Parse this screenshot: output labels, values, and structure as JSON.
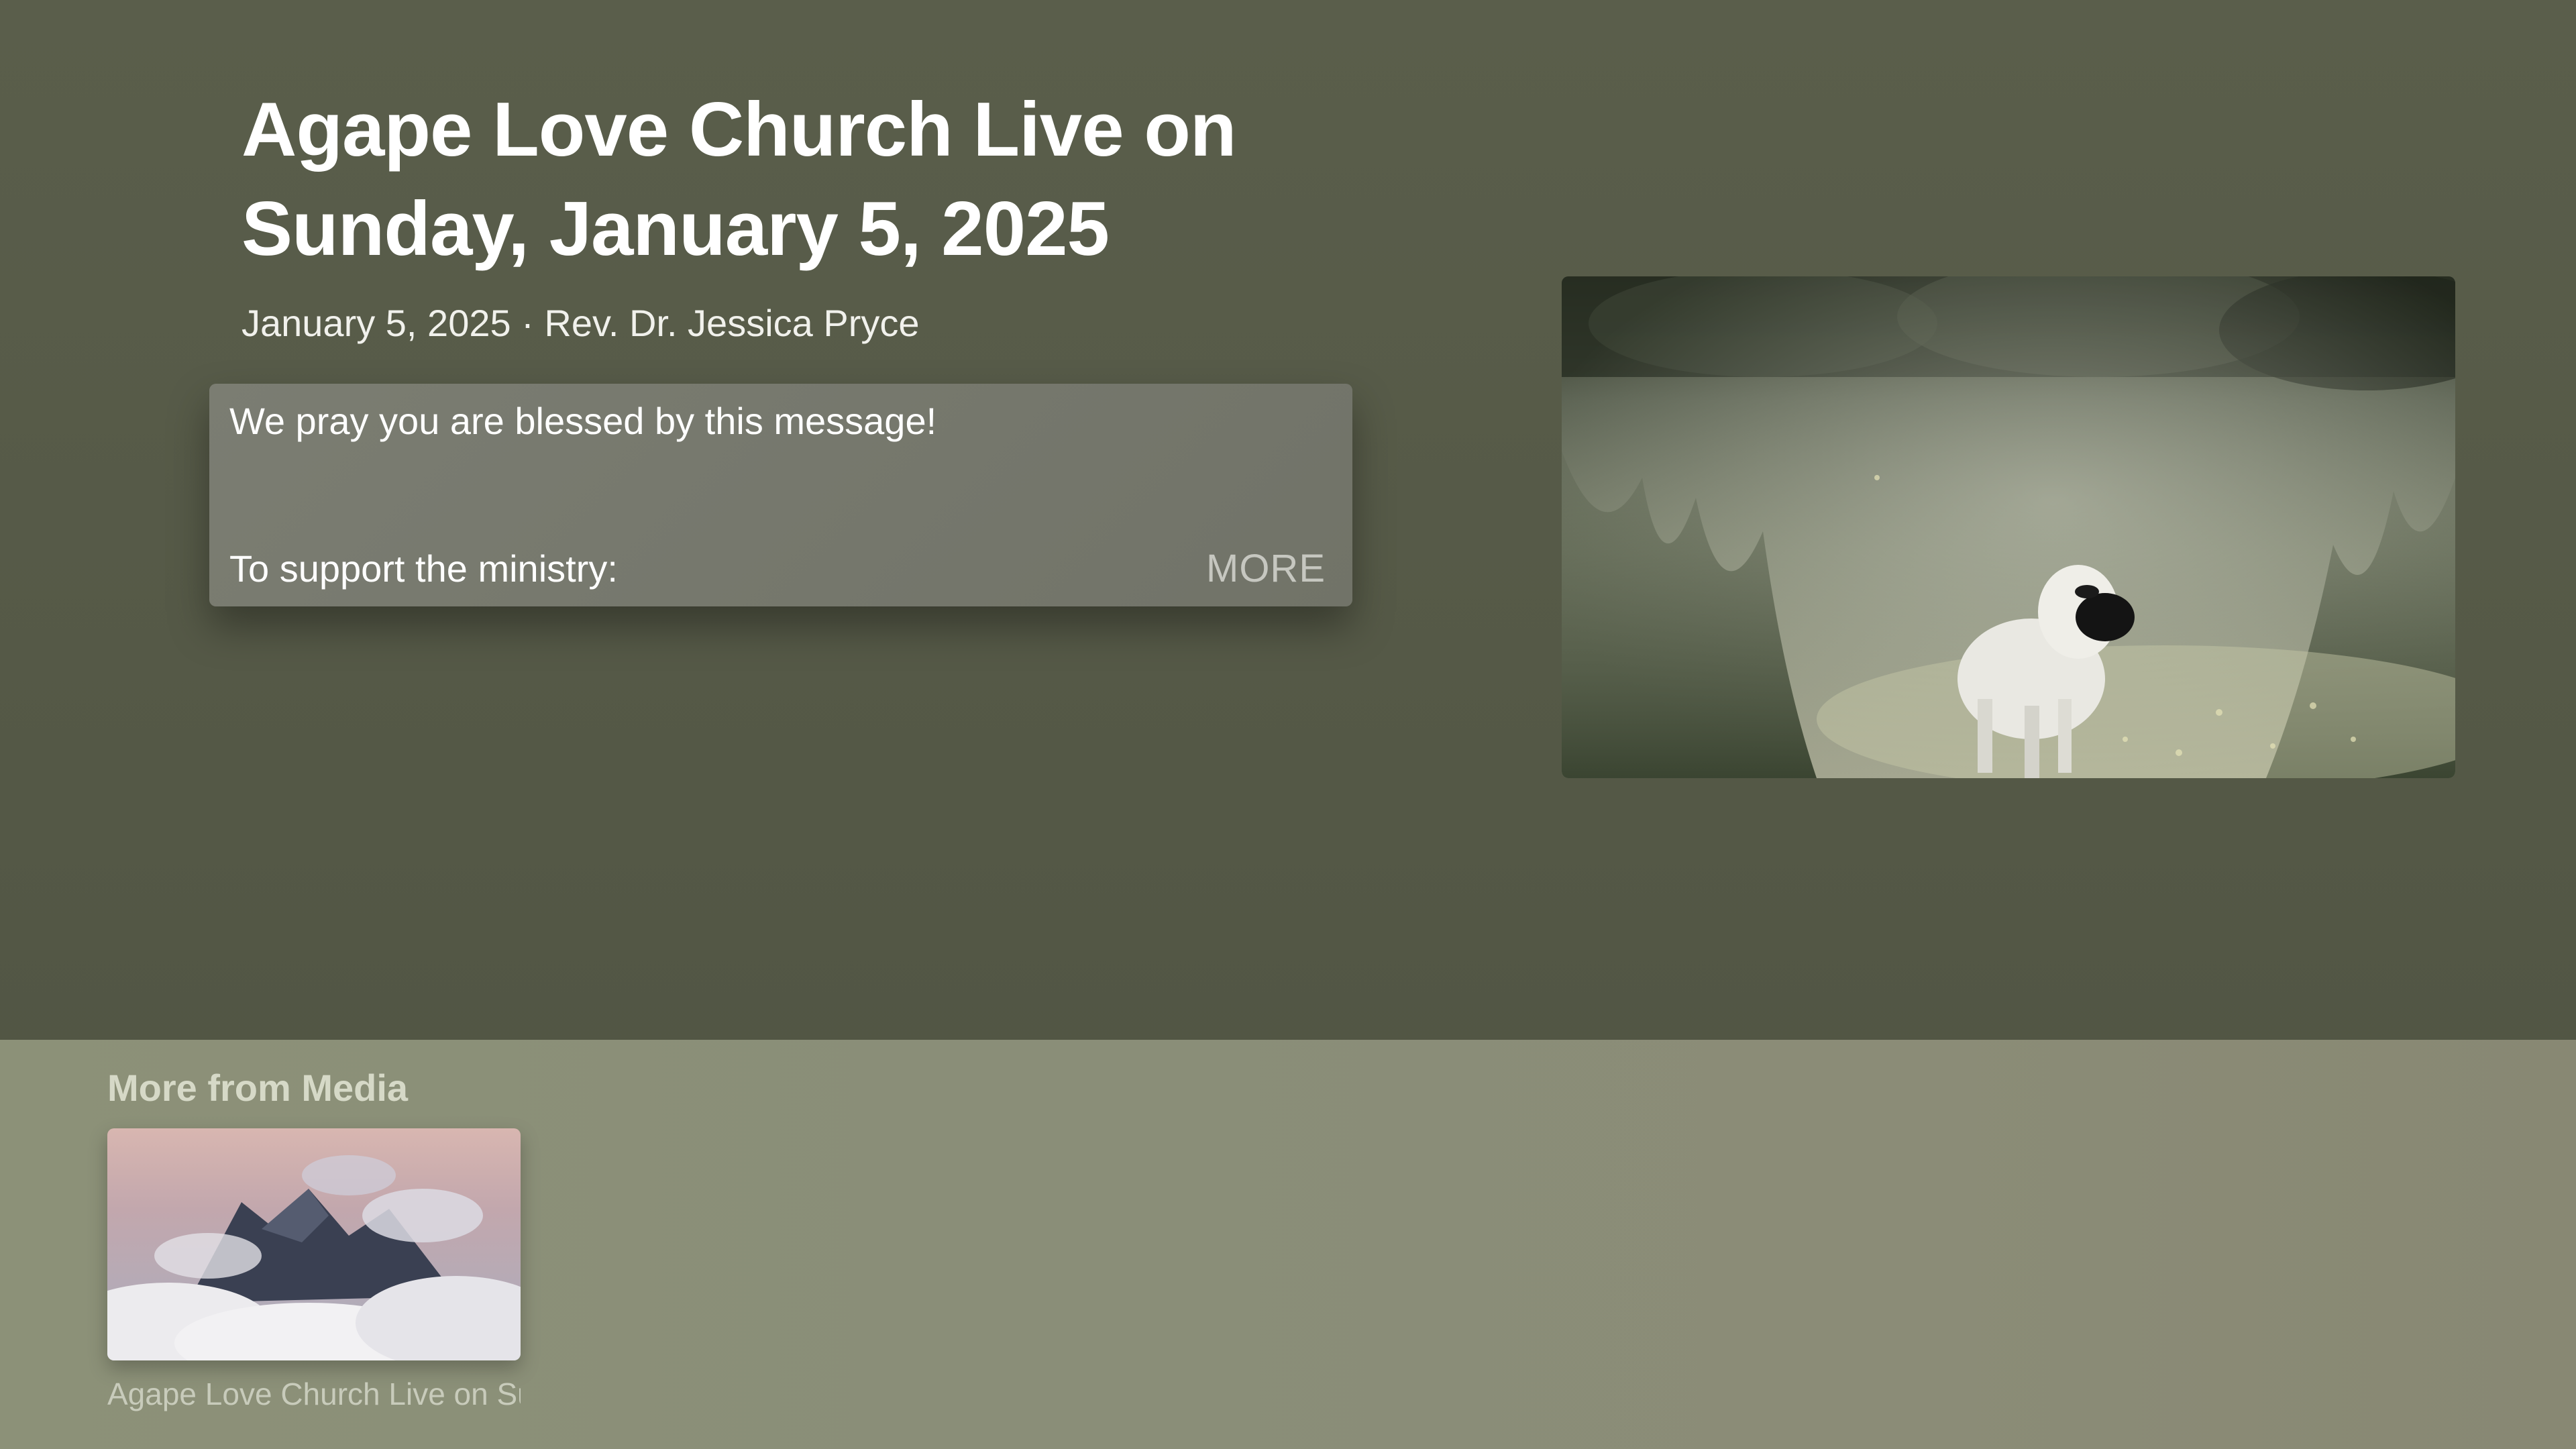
{
  "header": {
    "title": "Agape Love Church Live on Sunday, January 5, 2025",
    "meta": "January 5, 2025 · Rev. Dr. Jessica Pryce"
  },
  "description": {
    "line1": "We pray you are blessed by this message!",
    "line2": "To support the ministry:",
    "more_label": "MORE"
  },
  "hero": {
    "image": "lamb-in-meadow-photo"
  },
  "shelf": {
    "title": "More from Media",
    "items": [
      {
        "caption": "Agape Love Church Live on Su",
        "image": "mountain-clouds-photo"
      }
    ]
  }
}
